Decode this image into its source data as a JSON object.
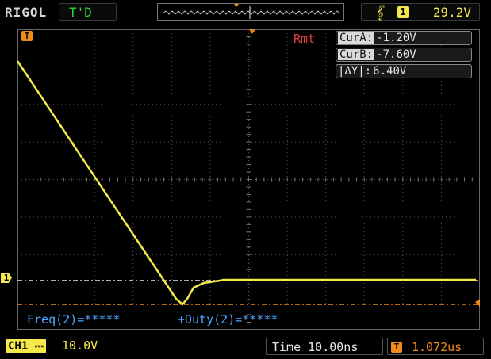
{
  "header": {
    "brand": "RIGOL",
    "trigger_status": "T'D",
    "trigger_channel": "1",
    "trigger_level": "29.2V",
    "trigger_slope_icon": "rising-edge-icon"
  },
  "cursors": {
    "mode": "Rmt",
    "rows": [
      {
        "label": "CurA:",
        "value": "-1.20V"
      },
      {
        "label": "CurB:",
        "value": "-7.60V"
      },
      {
        "label": "|ΔY|:",
        "value": "6.40V"
      }
    ]
  },
  "measurements": {
    "freq": "Freq(2)=*****",
    "duty": "+Duty(2)=*****"
  },
  "markers": {
    "channel_marker": "1",
    "trigger_marker": "T"
  },
  "footer": {
    "channel_label": "CH1",
    "channel_scale": "10.0V",
    "time_base": "Time 10.00ns",
    "trigger_delay_marker": "T",
    "trigger_delay": "1.072us"
  },
  "colors": {
    "ch1": "#f4e84a",
    "trigger": "#f08a1a",
    "measure": "#49a7ff",
    "remote": "#e24040",
    "status": "#28d628"
  }
}
